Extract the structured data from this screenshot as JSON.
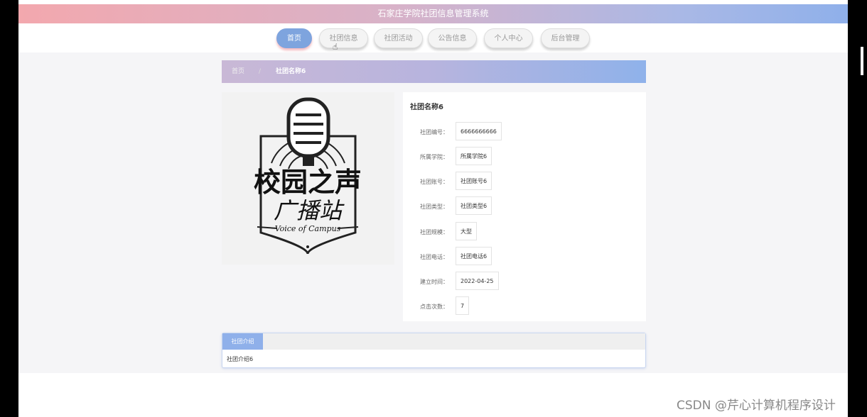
{
  "app": {
    "title": "石家庄学院社团信息管理系统"
  },
  "nav": {
    "items": [
      {
        "label": "首页"
      },
      {
        "label": "社团信息"
      },
      {
        "label": "社团活动"
      },
      {
        "label": "公告信息"
      },
      {
        "label": "个人中心"
      },
      {
        "label": "后台管理"
      }
    ],
    "active_index": 0
  },
  "breadcrumb": {
    "home": "首页",
    "separator": "/",
    "current": "社团名称6"
  },
  "poster": {
    "headline": "校园之声",
    "subheadline": "广播站",
    "tagline": "Voice of Campus"
  },
  "club": {
    "name": "社团名称6",
    "fields": [
      {
        "label": "社团编号：",
        "value": "6666666666"
      },
      {
        "label": "所属学院：",
        "value": "所属学院6"
      },
      {
        "label": "社团账号：",
        "value": "社团账号6"
      },
      {
        "label": "社团类型：",
        "value": "社团类型6"
      },
      {
        "label": "社团规模：",
        "value": "大型"
      },
      {
        "label": "社团电话：",
        "value": "社团电话6"
      },
      {
        "label": "建立时间：",
        "value": "2022-04-25"
      },
      {
        "label": "点击次数：",
        "value": "7"
      }
    ]
  },
  "intro": {
    "tab_label": "社团介绍",
    "text": "社团介绍6"
  },
  "watermark": "CSDN @芹心计算机程序设计",
  "colors": {
    "accent": "#8fb0ea",
    "title_gradient_start": "#f3a8ae",
    "title_gradient_end": "#8fb0ea"
  }
}
